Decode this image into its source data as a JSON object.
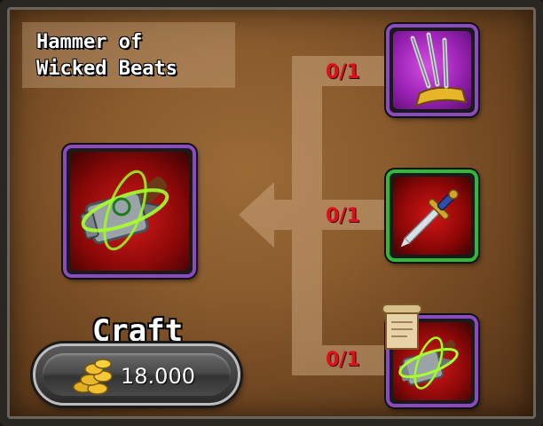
{
  "recipe": {
    "title": "Hammer of\nWicked Beats",
    "result_item": {
      "name": "hammer-of-wicked-beats",
      "icon": "glowing-hammer-icon",
      "rarity_color": "#8a4bc0"
    },
    "ingredients": [
      {
        "icon": "golden-claw-icon",
        "count": "0/1",
        "rarity_color": "#8a4bc0"
      },
      {
        "icon": "dagger-icon",
        "count": "0/1",
        "rarity_color": "#2fb83a"
      },
      {
        "icon": "hammer-recipe-scroll-icon",
        "count": "0/1",
        "rarity_color": "#8a4bc0"
      }
    ]
  },
  "craft": {
    "label": "Craft",
    "cost": "18.000",
    "currency_icon": "gold-coins-icon"
  },
  "colors": {
    "count_text": "#e0101a",
    "panel_bg": "#8a5b2d",
    "arrow": "#c9a27a"
  }
}
